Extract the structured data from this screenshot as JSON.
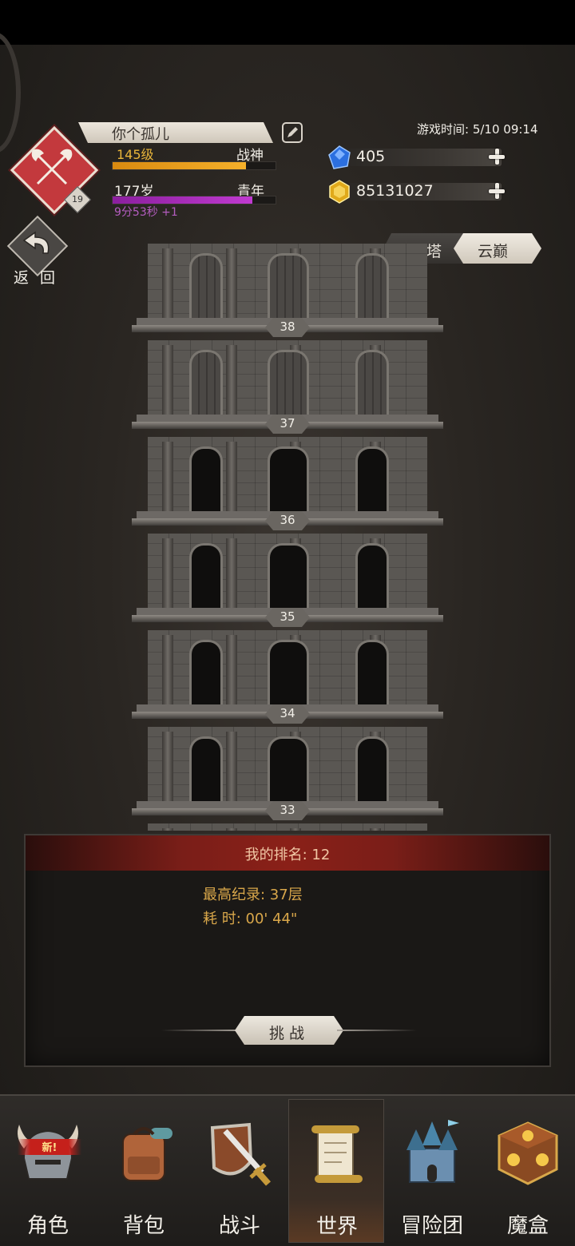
{
  "player": {
    "name": "你个孤儿",
    "emblem_level": "19",
    "level": "145级",
    "rank_title": "战神",
    "level_progress": 0.82,
    "age": "177岁",
    "life_stage": "青年",
    "age_progress": 0.86,
    "timer": "9分53秒 +1"
  },
  "game_time": "游戏时间: 5/10 09:14",
  "currencies": {
    "gems": "405",
    "gold": "85131027"
  },
  "back_label": "返 回",
  "tabs": {
    "tower": "通天塔",
    "peak": "云巅"
  },
  "tower_floors": [
    "38",
    "37",
    "36",
    "35",
    "34",
    "33"
  ],
  "panel": {
    "rank": "我的排名:  12",
    "best_record": "最高纪录:  37层",
    "time_used": "耗      时:  00' 44\"",
    "challenge_label": "挑战"
  },
  "nav": {
    "new_badge": "新!",
    "items": [
      "角色",
      "背包",
      "战斗",
      "世界",
      "冒险团",
      "魔盒"
    ],
    "active": "世界"
  },
  "colors": {
    "emblem": "#c3393d",
    "level_bar": "#f0a020",
    "age_bar": "#b030c0",
    "header_red": "#8a2018"
  }
}
